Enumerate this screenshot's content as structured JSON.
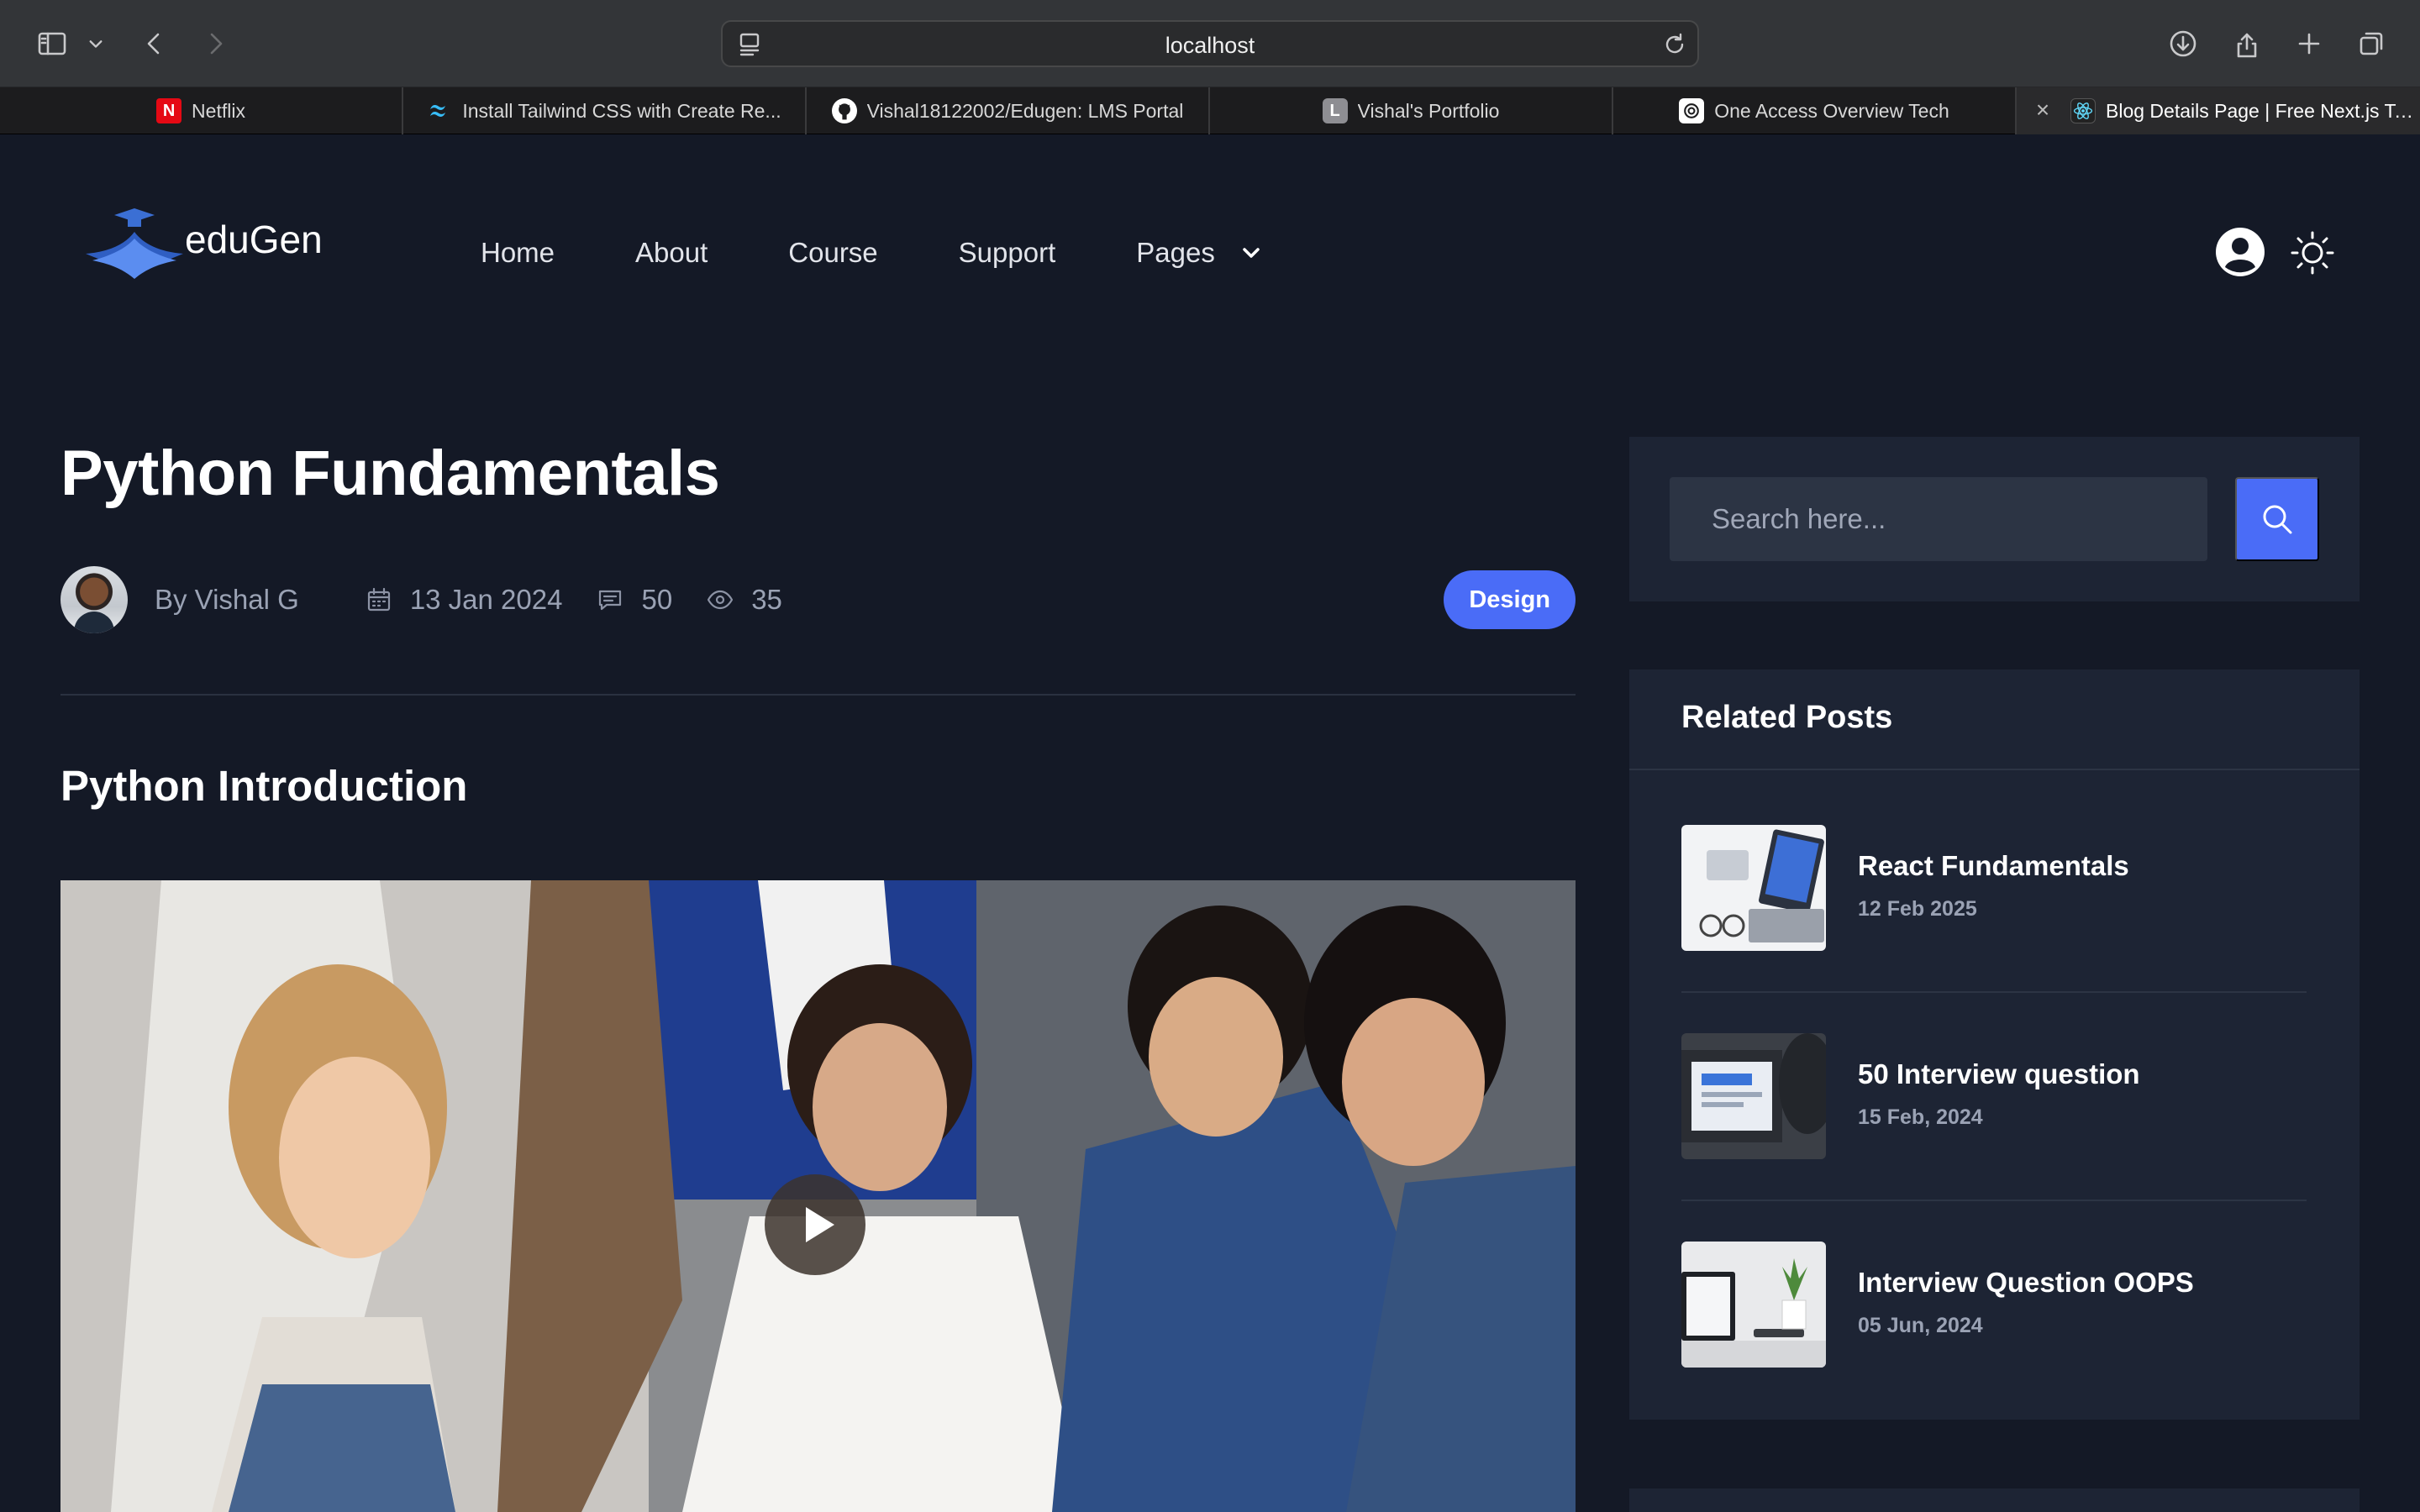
{
  "browser": {
    "url": "localhost",
    "tabs": [
      {
        "label": "Netflix",
        "icon": "netflix-icon"
      },
      {
        "label": "Install Tailwind CSS with Create Re...",
        "icon": "tailwind-icon"
      },
      {
        "label": "Vishal18122002/Edugen: LMS Portal",
        "icon": "github-icon"
      },
      {
        "label": "Vishal's Portfolio",
        "icon": "letter-l-icon",
        "icon_text": "L"
      },
      {
        "label": "One Access Overview Tech",
        "icon": "openai-icon"
      },
      {
        "label": "Blog Details Page | Free Next.js Te...",
        "icon": "react-icon",
        "active": true
      }
    ]
  },
  "site": {
    "logo_text": "eduGen",
    "nav": [
      "Home",
      "About",
      "Course",
      "Support",
      "Pages"
    ]
  },
  "article": {
    "title": "Python Fundamentals",
    "author": "By Vishal G",
    "date": "13 Jan 2024",
    "comments": "50",
    "views": "35",
    "tag": "Design",
    "section_title": "Python Introduction"
  },
  "sidebar": {
    "search_placeholder": "Search here...",
    "related_title": "Related Posts",
    "posts": [
      {
        "title": "React Fundamentals",
        "date": "12 Feb 2025"
      },
      {
        "title": "50 Interview question",
        "date": "15 Feb, 2024"
      },
      {
        "title": "Interview Question OOPS",
        "date": "05 Jun, 2024"
      }
    ]
  },
  "colors": {
    "background": "#141926",
    "panel": "#1d2434",
    "accent": "#4a6cf7"
  }
}
